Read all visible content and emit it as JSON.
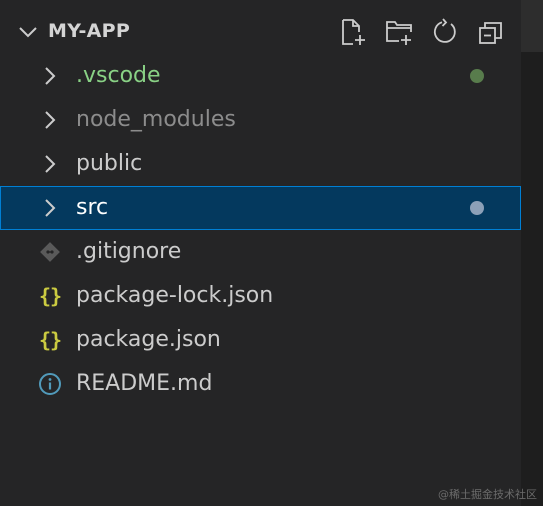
{
  "explorer": {
    "title": "MY-APP",
    "actions": [
      {
        "name": "new-file-icon",
        "label": "New File"
      },
      {
        "name": "new-folder-icon",
        "label": "New Folder"
      },
      {
        "name": "refresh-icon",
        "label": "Refresh Explorer"
      },
      {
        "name": "collapse-all-icon",
        "label": "Collapse Folders in Explorer"
      }
    ],
    "items": [
      {
        "label": ".vscode",
        "type": "folder",
        "color": "#89d185",
        "status_dot": "#587c4c"
      },
      {
        "label": "node_modules",
        "type": "folder",
        "color": "#8c8c8c"
      },
      {
        "label": "public",
        "type": "folder",
        "color": "#cccccc"
      },
      {
        "label": "src",
        "type": "folder",
        "color": "#ffffff",
        "selected": true,
        "status_dot": "#8ca0b8"
      },
      {
        "label": ".gitignore",
        "type": "file",
        "icon": "git-icon",
        "color": "#cccccc"
      },
      {
        "label": "package-lock.json",
        "type": "file",
        "icon": "json-icon",
        "color": "#cccccc"
      },
      {
        "label": "package.json",
        "type": "file",
        "icon": "json-icon",
        "color": "#cccccc"
      },
      {
        "label": "README.md",
        "type": "file",
        "icon": "info-icon",
        "color": "#cccccc"
      }
    ]
  },
  "colors": {
    "background": "#252526",
    "selection_bg": "#04395e",
    "selection_border": "#007fd4",
    "json_icon": "#cbcb41",
    "info_icon": "#519aba"
  },
  "watermark": "@稀土掘金技术社区"
}
